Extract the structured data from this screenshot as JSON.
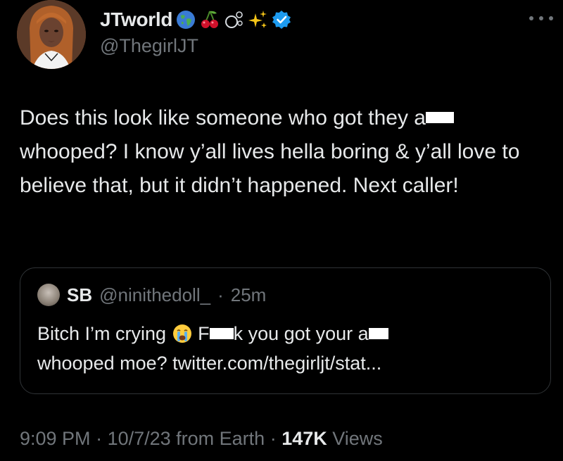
{
  "author": {
    "display_name": "JTworld",
    "handle": "@ThegirlJT",
    "name_emojis": [
      "globe-icon",
      "cherries-icon",
      "bubbles-icon",
      "sparkles-icon"
    ],
    "verified": true,
    "verified_color": "#1d9bf0"
  },
  "tweet": {
    "text_part1": "Does this look like someone who got they a",
    "text_part2": "whooped? I know y’all lives hella boring & y’all love to believe that, but it didn’t happened. Next caller!"
  },
  "quote": {
    "name": "SB",
    "handle": "@ninithedoll_",
    "separator": "·",
    "time": "25m",
    "text_part1": "Bitch I’m crying",
    "text_part2": "F",
    "text_part3": "k you got your a",
    "text_part4": "whooped moe? twitter.com/thegirljt/stat..."
  },
  "meta": {
    "time": "9:09 PM",
    "sep1": " · ",
    "date": "10/7/23",
    "source": " from Earth",
    "sep2": " · ",
    "views_count": "147K",
    "views_label": " Views"
  },
  "colors": {
    "background": "#000000",
    "text": "#e7e9ea",
    "secondary": "#71767b",
    "border": "#2f3336",
    "accent": "#1d9bf0"
  }
}
